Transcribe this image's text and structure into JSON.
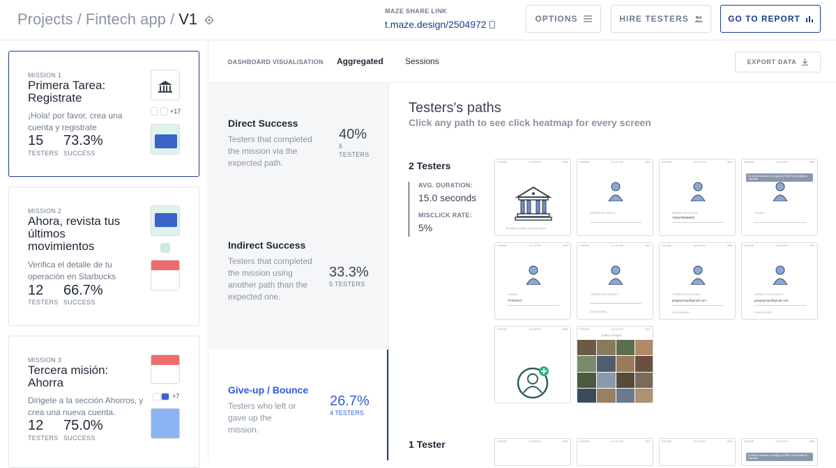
{
  "header": {
    "crumbs": [
      "Projects",
      "/",
      "Fintech app",
      "/",
      "V1"
    ],
    "share_label": "MAZE SHARE LINK",
    "share_link": "t.maze.design/2504972",
    "options_label": "OPTIONS",
    "hire_label": "HIRE TESTERS",
    "report_label": "GO TO REPORT",
    "accent": "#1b3a8a"
  },
  "missions": [
    {
      "label": "MISSION 1",
      "title": "Primera Tarea: Registrate",
      "desc": "¡Hola! por favor, crea una cuenta y registrate",
      "testers": "15",
      "testers_label": "TESTERS",
      "success": "73.3%",
      "success_label": "SUCCESS",
      "extra": "+17"
    },
    {
      "label": "MISSION 2",
      "title": "Ahora, revista tus últimos movimientos",
      "desc": "Verifica el detalle de tu operación en Starbucks",
      "testers": "12",
      "testers_label": "TESTERS",
      "success": "66.7%",
      "success_label": "SUCCESS"
    },
    {
      "label": "MISSION 3",
      "title": "Tercera misión: Ahorra",
      "desc": "Dirigete a la sección Ahorros, y crea una nueva cuenta.",
      "testers": "12",
      "testers_label": "TESTERS",
      "success": "75.0%",
      "success_label": "SUCCESS",
      "extra": "+7"
    }
  ],
  "tabs": {
    "dashboard_label": "DASHBOARD VISUALISATION",
    "aggregated": "Aggregated",
    "sessions": "Sessions",
    "export_label": "EXPORT DATA"
  },
  "stats": [
    {
      "title": "Direct Success",
      "desc": "Testers that completed the mission via the expected path.",
      "pct": "40%",
      "count": "6",
      "count_label": "TESTERS"
    },
    {
      "title": "Indirect Success",
      "desc": "Testers that completed the mission using another path than the expected one.",
      "pct": "33.3%",
      "count_label": "5 TESTERS"
    },
    {
      "title": "Give-up / Bounce",
      "desc": "Testers who left or gave up the mission.",
      "pct": "26.7%",
      "count_label": "4 TESTERS"
    }
  ],
  "paths": {
    "title": "Testers's paths",
    "subtitle": "Click any path to see click heatmap for every screen",
    "group1": {
      "count": "2 Testers",
      "avg_label": "AVG. DURATION:",
      "avg_value": "15.0 seconds",
      "misclick_label": "MISCLICK RATE:",
      "misclick_value": "5%"
    },
    "group2": {
      "count": "1 Tester"
    },
    "screen": {
      "carrier": "PHONE",
      "time": "10:15 PM",
      "battery": "98%",
      "bank_caption": "El banco configu a donde vayas",
      "field_number": "NUMERO DE CUENTA",
      "field_dni": "NUMERO DE CUENTA",
      "val_dni": "YE56789888RE",
      "field_code": "CODIGO",
      "val_code": "YFE6SKO",
      "field_email": "CORREO ELECTRONICO",
      "val_email": "gregorymay@gmail.com",
      "field_pass": "CONTRASEÑA",
      "toast": "Se hemos enviado un código por SMS. Para continuar, ingrésalo.",
      "gallery_title": "Gallery images"
    }
  }
}
